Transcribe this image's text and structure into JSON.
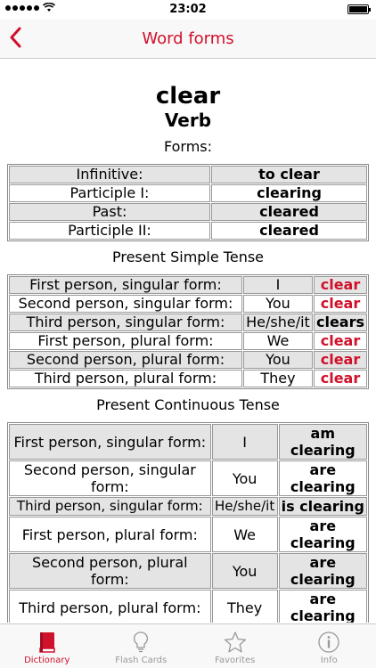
{
  "status_bar": {
    "time": "23:02"
  },
  "nav": {
    "title": "Word forms",
    "back_icon": "chevron-left-icon"
  },
  "word": "clear",
  "part_of_speech": "Verb",
  "forms_title": "Forms:",
  "forms": [
    {
      "label": "Infinitive:",
      "value": "to clear"
    },
    {
      "label": "Participle I:",
      "value": "clearing"
    },
    {
      "label": "Past:",
      "value": "cleared"
    },
    {
      "label": "Participle II:",
      "value": "cleared"
    }
  ],
  "present_simple_title": "Present Simple Tense",
  "present_simple": [
    {
      "label": "First person, singular form:",
      "pronoun": "I",
      "form": "clear"
    },
    {
      "label": "Second person, singular form:",
      "pronoun": "You",
      "form": "clear"
    },
    {
      "label": "Third person, singular form:",
      "pronoun": "He/she/it",
      "form": "clears"
    },
    {
      "label": "First person, plural form:",
      "pronoun": "We",
      "form": "clear"
    },
    {
      "label": "Second person, plural form:",
      "pronoun": "You",
      "form": "clear"
    },
    {
      "label": "Third person, plural form:",
      "pronoun": "They",
      "form": "clear"
    }
  ],
  "present_continuous_title": "Present Continuous Tense",
  "present_continuous": [
    {
      "label": "First person, singular form:",
      "pronoun": "I",
      "form": "am clearing"
    },
    {
      "label": "Second person, singular form:",
      "pronoun": "You",
      "form": "are clearing"
    },
    {
      "label": "Third person, singular form:",
      "pronoun": "He/she/it",
      "form": "is clearing"
    },
    {
      "label": "First person, plural form:",
      "pronoun": "We",
      "form": "are clearing"
    },
    {
      "label": "Second person, plural form:",
      "pronoun": "You",
      "form": "are clearing"
    },
    {
      "label": "Third person, plural form:",
      "pronoun": "They",
      "form": "are clearing"
    }
  ],
  "tabs": [
    {
      "label": "Dictionary",
      "icon": "book-icon",
      "active": true
    },
    {
      "label": "Flash Cards",
      "icon": "lightbulb-icon",
      "active": false
    },
    {
      "label": "Favorites",
      "icon": "star-icon",
      "active": false
    },
    {
      "label": "Info",
      "icon": "info-icon",
      "active": false
    }
  ],
  "colors": {
    "accent": "#d0112b",
    "inactive": "#999999",
    "row_shade": "#e4e4e4"
  }
}
